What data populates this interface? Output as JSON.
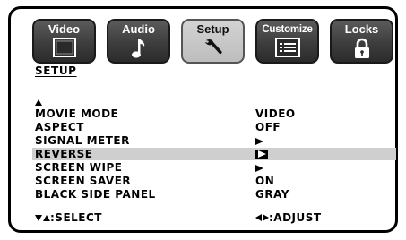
{
  "tabs": [
    {
      "label": "Video",
      "icon": "monitor-icon",
      "active": false
    },
    {
      "label": "Audio",
      "icon": "music-note-icon",
      "active": false
    },
    {
      "label": "Setup",
      "icon": "wrench-icon",
      "active": true
    },
    {
      "label": "Customize",
      "icon": "list-icon",
      "active": false
    },
    {
      "label": "Locks",
      "icon": "padlock-icon",
      "active": false
    }
  ],
  "section_title": "SETUP",
  "menu": [
    {
      "label": "MOVIE MODE",
      "value": "VIDEO"
    },
    {
      "label": "ASPECT",
      "value": "OFF"
    },
    {
      "label": "SIGNAL METER",
      "value": ""
    },
    {
      "label": "REVERSE",
      "value": "",
      "highlighted": true
    },
    {
      "label": "SCREEN WIPE",
      "value": ""
    },
    {
      "label": "SCREEN SAVER",
      "value": "ON"
    },
    {
      "label": "BLACK SIDE PANEL",
      "value": "GRAY"
    }
  ],
  "footer": {
    "select_hint": ":SELECT",
    "adjust_hint": ":ADJUST"
  },
  "colors": {
    "tab_dark": "#3d3d3d",
    "tab_active": "#c8c8c8",
    "highlight": "#cfcfcf"
  }
}
